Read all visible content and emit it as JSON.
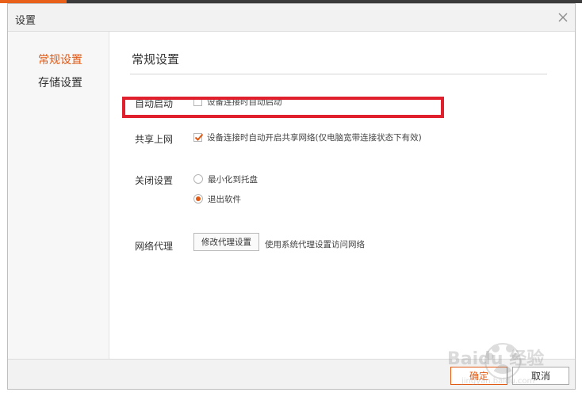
{
  "dialog": {
    "title": "设置",
    "close_icon": "close-icon"
  },
  "sidebar": {
    "items": [
      {
        "label": "常规设置",
        "active": true
      },
      {
        "label": "存储设置",
        "active": false
      }
    ]
  },
  "content": {
    "section_title": "常规设置",
    "auto_start": {
      "label": "自动启动",
      "option": "设备连接时自动启动",
      "checked": false
    },
    "share_network": {
      "label": "共享上网",
      "option": "设备连接时自动开启共享网络(仅电脑宽带连接状态下有效)",
      "checked": true
    },
    "close_settings": {
      "label": "关闭设置",
      "options": [
        {
          "label": "最小化到托盘",
          "selected": false
        },
        {
          "label": "退出软件",
          "selected": true
        }
      ]
    },
    "proxy": {
      "label": "网络代理",
      "button_label": "修改代理设置",
      "note": "使用系统代理设置访问网络"
    }
  },
  "footer": {
    "ok_label": "确定",
    "cancel_label": "取消"
  },
  "colors": {
    "accent": "#e05a16",
    "annotation_red": "#e0202c"
  },
  "watermark": {
    "text": "Baidu 经验",
    "subtext": "jingyan.baidu.com"
  }
}
